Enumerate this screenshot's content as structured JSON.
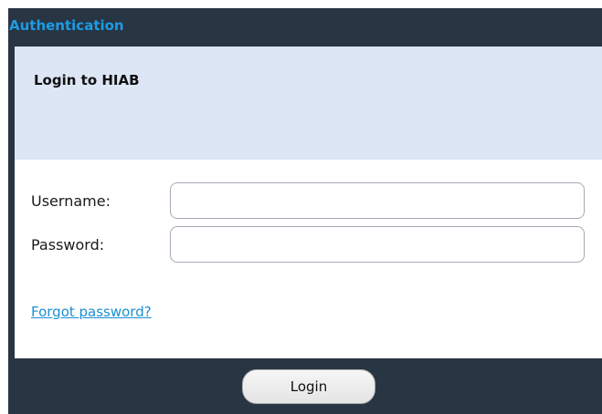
{
  "window": {
    "title": "Authentication"
  },
  "header": {
    "heading": "Login to HIAB"
  },
  "form": {
    "username_label": "Username:",
    "username_value": "",
    "password_label": "Password:",
    "password_value": "",
    "forgot_link": "Forgot password?"
  },
  "footer": {
    "login_label": "Login"
  },
  "colors": {
    "titlebar_bg": "#283542",
    "title_text": "#1c9be6",
    "header_bg": "#dce6f5",
    "link": "#1a8fd6"
  }
}
